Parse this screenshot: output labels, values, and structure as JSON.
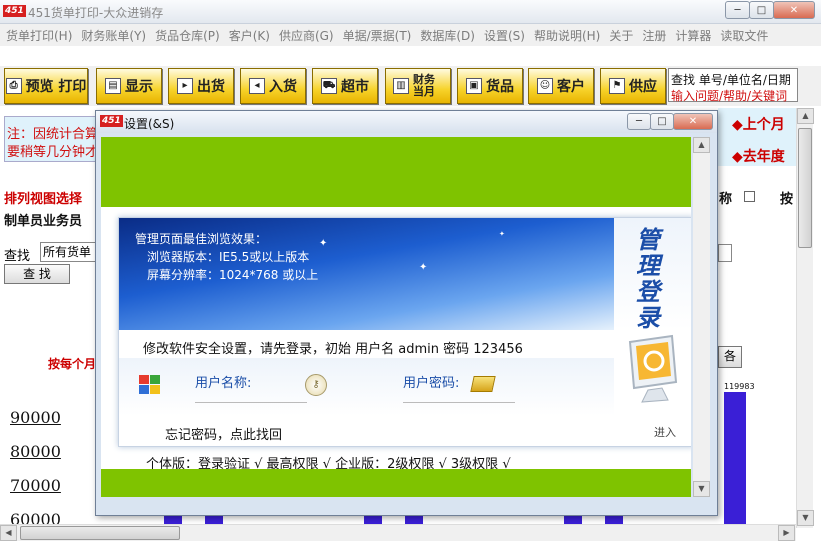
{
  "app": {
    "logo_text": "451",
    "title": "451货单打印-大众进销存",
    "menu": [
      "货单打印(H)",
      "财务账单(Y)",
      "货品仓库(P)",
      "客户(K)",
      "供应商(G)",
      "单据/票据(T)",
      "数据库(D)",
      "设置(S)",
      "帮助说明(H)",
      "关于",
      "注册",
      "计算器",
      "读取文件"
    ]
  },
  "toolbar": {
    "buttons": [
      {
        "label": "预览 打印",
        "icon": "printer-icon"
      },
      {
        "label": "显示",
        "icon": "display-icon"
      },
      {
        "label": "出货",
        "icon": "document-out-icon"
      },
      {
        "label": "入货",
        "icon": "document-in-icon"
      },
      {
        "label": "超市",
        "icon": "cart-icon"
      },
      {
        "label": "财务当月",
        "icon": "bar-chart-icon"
      },
      {
        "label": "货品",
        "icon": "gift-box-icon"
      },
      {
        "label": "客户",
        "icon": "people-icon"
      },
      {
        "label": "供应",
        "icon": "supplier-icon"
      }
    ],
    "search_line1": "查找 单号/单位名/日期",
    "search_line2": "输入问题/帮助/关键词"
  },
  "notice": {
    "line1": "注：因统计合算",
    "line2": "要稍等几分钟才"
  },
  "right_links": {
    "prev_month": "◆上个月",
    "last_year": "◆去年度"
  },
  "background": {
    "view_select_label": "排列视图选择",
    "operator_label": "制单员业务员",
    "search_label": "查找",
    "search_value": "所有货单",
    "search_button": "查 找",
    "monthly_label": "按每个月",
    "name_label": "称",
    "press_label": "按",
    "right_btn_label": "各",
    "bar_value_label": "119983"
  },
  "chart_data": {
    "type": "bar",
    "yticks": [
      "90000",
      "80000",
      "70000",
      "60000"
    ]
  },
  "dialog": {
    "logo_text": "451",
    "title": "设置(&S)",
    "banner_title": "管理页面最佳浏览效果：",
    "banner_browser": "浏览器版本：IE5.5或以上版本",
    "banner_resolution": "屏幕分辨率：1024*768 或以上",
    "side_title": [
      "管",
      "理",
      "登",
      "录"
    ],
    "message": "修改软件安全设置，请先登录，初始 用户名 admin 密码 123456",
    "username_label": "用户名称:",
    "password_label": "用户密码:",
    "forgot": "忘记密码，点此找回",
    "enter": "进入",
    "versions": "个体版：登录验证 √  最高权限 √   企业版：2级权限 √  3级权限 √"
  },
  "colors": {
    "green": "#7fc300",
    "bar": "#3a1fd6",
    "accent_red": "#cc0000",
    "title_blue": "#1b4ea8"
  }
}
